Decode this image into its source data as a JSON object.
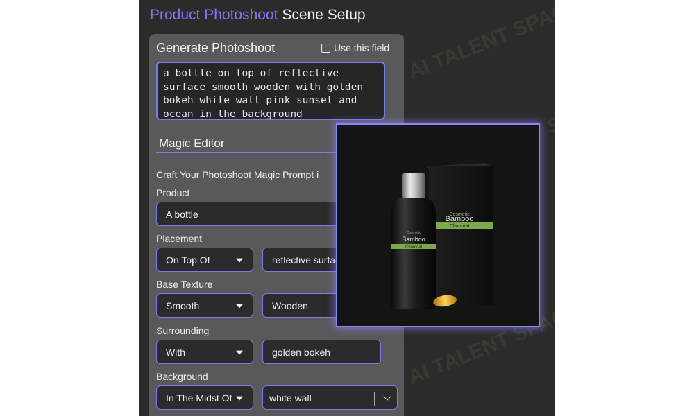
{
  "header": {
    "title_accent": "Product Photoshoot",
    "title_rest": "Scene Setup"
  },
  "generate": {
    "title": "Generate Photoshoot",
    "use_field_label": "Use this field",
    "use_field_checked": false,
    "prompt_value": "a bottle on top of reflective\nsurface smooth wooden with golden\nbokeh white wall pink sunset and\nocean in the background"
  },
  "magic_editor": {
    "title": "Magic Editor",
    "helper": "Craft Your Photoshoot Magic Prompt i",
    "product": {
      "label": "Product",
      "value": "A bottle"
    },
    "placement": {
      "label": "Placement",
      "select": "On Top Of",
      "value": "reflective surface"
    },
    "base_texture": {
      "label": "Base Texture",
      "select": "Smooth",
      "value": "Wooden"
    },
    "surrounding": {
      "label": "Surrounding",
      "select": "With",
      "value": "golden bokeh"
    },
    "background": {
      "label": "Background",
      "select": "In The Midst Of",
      "value": "white wall"
    }
  },
  "preview": {
    "bottle_brand": "Bamboo",
    "bottle_sub": "Charcoal",
    "bottle_maker": "Cosmetic",
    "box_brand": "Bamboo",
    "box_sub": "Charcoal",
    "box_maker": "Cosmetic"
  },
  "watermark": "AI TALENT SPACE",
  "colors": {
    "accent": "#7e78f2",
    "app_bg": "#2b2b2b",
    "panel_bg": "#595959",
    "label_green": "#7ea84c"
  }
}
